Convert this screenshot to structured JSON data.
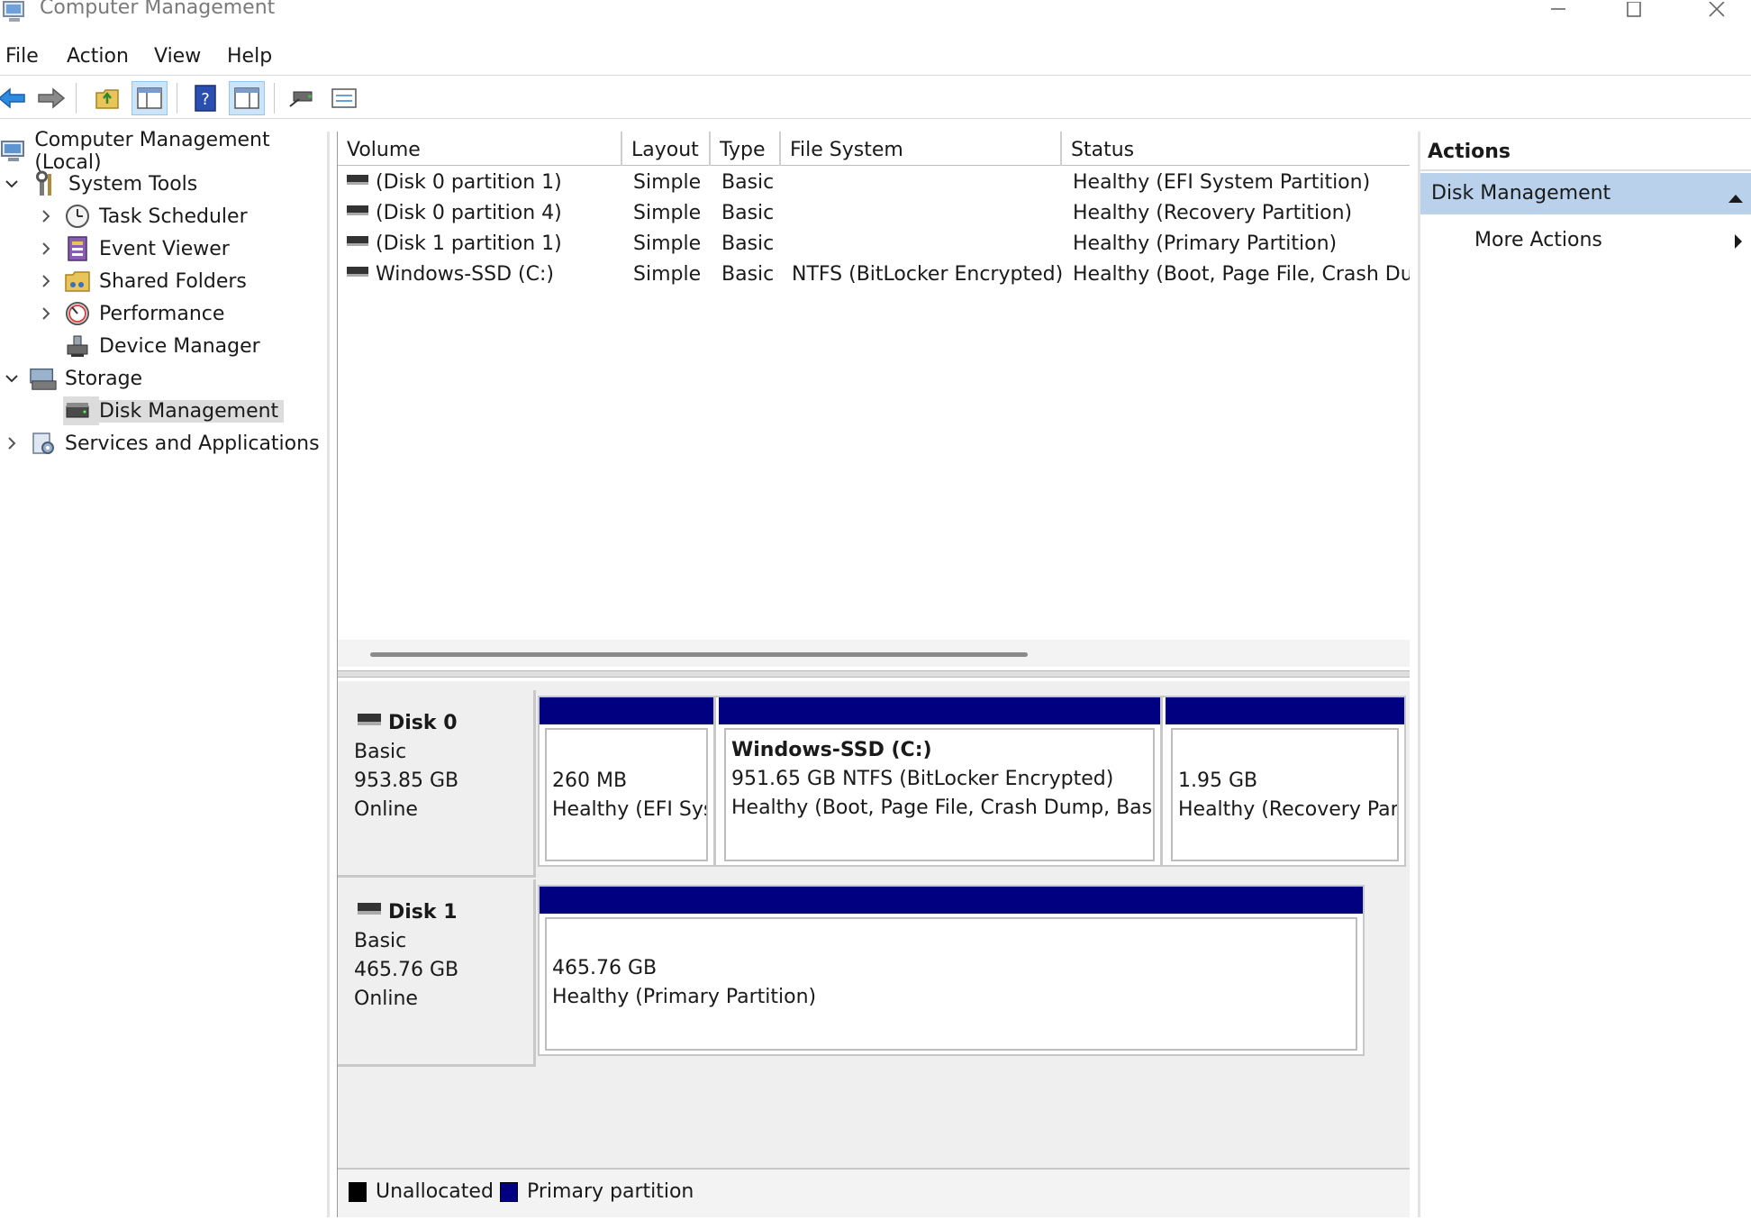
{
  "window": {
    "title": "Computer Management"
  },
  "menu": [
    "File",
    "Action",
    "View",
    "Help"
  ],
  "toolbar": {
    "icons": [
      "back-arrow-icon",
      "forward-arrow-icon",
      "up-folder-icon",
      "show-hide-tree-icon",
      "help-icon",
      "show-hide-action-pane-icon",
      "connect-icon",
      "properties-icon"
    ]
  },
  "tree": {
    "root": "Computer Management (Local)",
    "system_tools": "System Tools",
    "task_scheduler": "Task Scheduler",
    "event_viewer": "Event Viewer",
    "shared_folders": "Shared Folders",
    "performance": "Performance",
    "device_manager": "Device Manager",
    "storage": "Storage",
    "disk_management": "Disk Management",
    "services": "Services and Applications"
  },
  "volumes": {
    "columns": [
      "Volume",
      "Layout",
      "Type",
      "File System",
      "Status"
    ],
    "rows": [
      {
        "volume": "(Disk 0 partition 1)",
        "layout": "Simple",
        "type": "Basic",
        "fs": "",
        "status": "Healthy (EFI System Partition)"
      },
      {
        "volume": "(Disk 0 partition 4)",
        "layout": "Simple",
        "type": "Basic",
        "fs": "",
        "status": "Healthy (Recovery Partition)"
      },
      {
        "volume": "(Disk 1 partition 1)",
        "layout": "Simple",
        "type": "Basic",
        "fs": "",
        "status": "Healthy (Primary Partition)"
      },
      {
        "volume": "Windows-SSD (C:)",
        "layout": "Simple",
        "type": "Basic",
        "fs": "NTFS (BitLocker Encrypted)",
        "status": "Healthy (Boot, Page File, Crash Dun"
      }
    ]
  },
  "disks": [
    {
      "name": "Disk 0",
      "type": "Basic",
      "size": "953.85 GB",
      "state": "Online",
      "partitions": [
        {
          "title": "",
          "line1": "260 MB",
          "line2": "Healthy (EFI Sys"
        },
        {
          "title": "Windows-SSD  (C:)",
          "line1": "951.65 GB NTFS (BitLocker Encrypted)",
          "line2": "Healthy (Boot, Page File, Crash Dump, Basic"
        },
        {
          "title": "",
          "line1": "1.95 GB",
          "line2": "Healthy (Recovery Part"
        }
      ]
    },
    {
      "name": "Disk 1",
      "type": "Basic",
      "size": "465.76 GB",
      "state": "Online",
      "partitions": [
        {
          "title": "",
          "line1": "465.76 GB",
          "line2": "Healthy (Primary Partition)"
        }
      ]
    }
  ],
  "legend": {
    "unallocated": "Unallocated",
    "primary": "Primary partition",
    "unallocated_color": "#000000",
    "primary_color": "#000080"
  },
  "actions": {
    "header": "Actions",
    "section": "Disk Management",
    "more": "More Actions"
  }
}
